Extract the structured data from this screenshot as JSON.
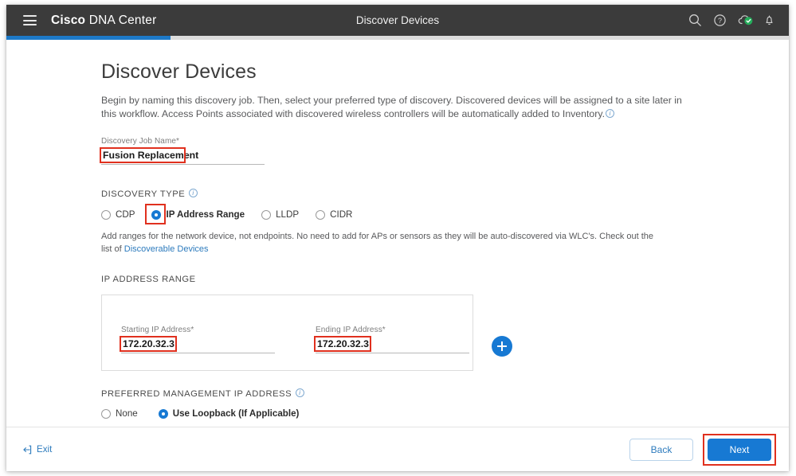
{
  "topbar": {
    "menu_icon": "hamburger-icon",
    "brand_bold": "Cisco",
    "brand_rest": " DNA Center",
    "title": "Discover Devices",
    "icons": [
      {
        "name": "search-icon"
      },
      {
        "name": "help-icon"
      },
      {
        "name": "cloud-connected-icon"
      },
      {
        "name": "notifications-bell-icon"
      }
    ]
  },
  "progress": {
    "percent": 21
  },
  "page": {
    "title": "Discover Devices",
    "intro_line1": "Begin by naming this discovery job. Then, select your preferred type of discovery. Discovered devices will be assigned to a site later in this",
    "intro_line2": "workflow. Access Points associated with discovered wireless controllers will be automatically added to Inventory."
  },
  "job_name": {
    "label": "Discovery Job Name*",
    "value": "Fusion Replacement",
    "placeholder": ""
  },
  "discovery_type": {
    "heading": "DISCOVERY TYPE",
    "options": [
      {
        "label": "CDP",
        "selected": false
      },
      {
        "label": "IP Address Range",
        "selected": true
      },
      {
        "label": "LLDP",
        "selected": false
      },
      {
        "label": "CIDR",
        "selected": false
      }
    ],
    "helper_text": "Add ranges for the network device, not endpoints. No need to add for APs or sensors as they will be auto-discovered via WLC's. Check out the list of",
    "helper_link": "Discoverable Devices"
  },
  "ip_range": {
    "heading": "IP ADDRESS RANGE",
    "start": {
      "label": "Starting IP Address*",
      "value": "172.20.32.3"
    },
    "end": {
      "label": "Ending IP Address*",
      "value": "172.20.32.3"
    },
    "add_button": "add-range-button"
  },
  "preferred_mgmt": {
    "heading": "PREFERRED MANAGEMENT IP ADDRESS",
    "options": [
      {
        "label": "None",
        "selected": false
      },
      {
        "label": "Use Loopback (If Applicable)",
        "selected": true
      }
    ]
  },
  "footer": {
    "exit_label": "Exit",
    "back_label": "Back",
    "next_label": "Next"
  },
  "colors": {
    "accent_blue": "#1779d3",
    "topbar_dark": "#3b3b3b",
    "annotation_red": "#e0301e",
    "status_green": "#25ad5b"
  }
}
